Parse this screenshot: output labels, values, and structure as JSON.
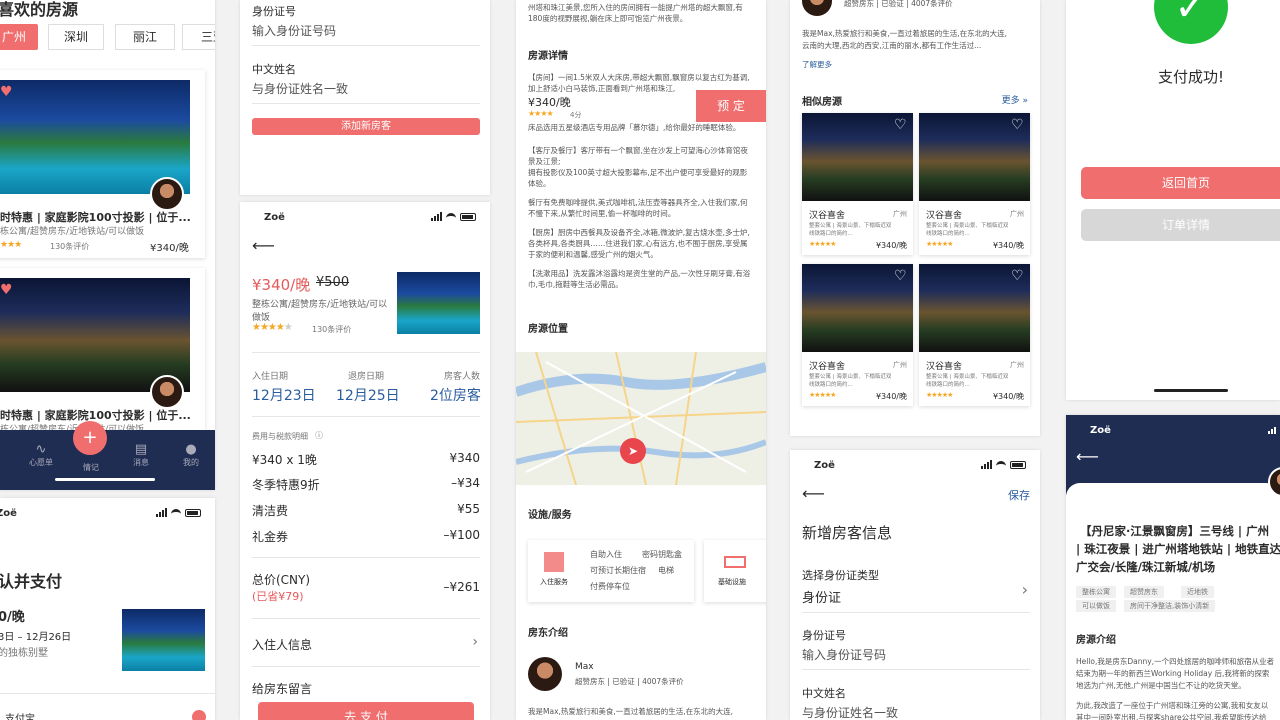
{
  "s1": {
    "title": "喜欢的房源",
    "cities": [
      "广州",
      "深圳",
      "丽江",
      "三亚"
    ],
    "card1_title": "时特惠 | 家庭影院100寸投影 | 位于...",
    "card1_sub": "栋公寓/超赞房东/近地铁站/可以做饭",
    "card1_reviews": "130条评价",
    "card1_price": "¥340/晚",
    "card2_title": "时特惠 | 家庭影院100寸投影 | 位于...",
    "card2_sub": "栋公寓/超赞房东/近地铁站/可以做饭",
    "nav": [
      "心愿单",
      "情记",
      "消息",
      "我的"
    ],
    "fab": "+"
  },
  "s2": {
    "name": "Zoë",
    "title": "认并支付",
    "price": "0/晚",
    "dates": "3日 – 12月26日",
    "desc": "的独栋别墅",
    "bottom": "支付宝"
  },
  "s3": {
    "id_label": "身份证号",
    "id_placeholder": "输入身份证号码",
    "name_label": "中文姓名",
    "name_placeholder": "与身份证姓名一致",
    "add_btn": "添加新房客"
  },
  "s4": {
    "name": "Zoë",
    "price": "¥340/晚",
    "orig": "¥500",
    "sub1": "整栋公寓/超赞房东/近地铁站/可以",
    "sub2": "做饭",
    "reviews": "130条评价",
    "checkin_label": "入住日期",
    "checkout_label": "退房日期",
    "guests_label": "房客人数",
    "checkin": "12月23日",
    "checkout": "12月25日",
    "guests": "2位房客",
    "fee_title": "费用与税款明细",
    "fees": [
      {
        "k": "¥340 x 1晚",
        "v": "¥340"
      },
      {
        "k": "冬季特惠9折",
        "v": "–¥34"
      },
      {
        "k": "清洁费",
        "v": "¥55"
      },
      {
        "k": "礼金券",
        "v": "–¥100"
      }
    ],
    "total_label": "总价(CNY)",
    "saved": "(已省¥79)",
    "total": "–¥261",
    "guest_info": "入住人信息",
    "msg": "给房东留言",
    "pay": "去 支 付"
  },
  "s5": {
    "intro_top": "州塔和珠江美景,您所入住的房间拥有一能提广州塔的超大飘窗,有180度的视野展视,躺在床上即可饱览广州夜景。",
    "detail_title": "房源详情",
    "detail": [
      "【房间】一间1.5米双人大床房,带超大飘窗,飘窗房以复古红为基调,加上舒适小白马装饰,正面看到广州塔和珠江,",
      "床品选用五星级酒店专用品牌「慕尔德」,给你最好的睡眠体验。",
      "【客厅及餐厅】客厅带有一个飘窗,坐在沙发上可望海心沙体育馆夜景及江景;",
      "拥有投影仪及100英寸超大投影幕布,足不出户便可享受最好的观影体验。",
      "餐厅有免费咖啡提供,美式咖啡机,法压壶等器具齐全,入住我们家,何不慢下来,从繁忙时间里,偷一杯咖啡的时间。",
      "【厨房】厨房中西餐具及设备齐全,冰箱,微波炉,复古烧水壶,多士炉,各类杯具,各类厨具……住进我们家,心有远方,也不囿于厨房,享受属于家的便利和温馨,感受广州的烟火气。",
      "【洗漱用品】洗发露沐浴露均是资生堂的产品,一次性牙刷牙膏,有浴巾,毛巾,拖鞋等生活必需品。"
    ],
    "float_price": "¥340/晚",
    "float_rating": "4分",
    "book": "预 定",
    "loc_title": "房源位置",
    "fac_title": "设施/服务",
    "fac1_label": "入住服务",
    "fac1_items": [
      "自助入住",
      "密码钥匙盒",
      "可预订长期住宿",
      "电梯",
      "付费停车位"
    ],
    "fac2_label": "基础设施",
    "host_title": "房东介绍",
    "host_name": "Max",
    "host_info": "超赞房东 | 已验证 | 4007条评价",
    "host_text": "我是Max,热爱旅行和美食,一直过着旅居的生活,在东北的大连,"
  },
  "s6": {
    "host_info": "超赞房东 | 已验证 | 4007条评价",
    "host_text1": "我是Max,热爱旅行和美食,一直过着旅居的生活,在东北的大连,",
    "host_text2": "云南的大理,西北的西安,江南的丽水,都有工作生活过...",
    "more": "了解更多",
    "similar": "相似房源",
    "more2": "更多 »",
    "listings": [
      {
        "name": "汉谷喜舍",
        "city": "广州",
        "desc1": "整套公寓 | 海景山景、下榻临近双",
        "desc2": "线铁路口的简约...",
        "price": "¥340/晚"
      },
      {
        "name": "汉谷喜舍",
        "city": "广州",
        "desc1": "整套公寓 | 海景山景、下榻临近双",
        "desc2": "线铁路口的简约...",
        "price": "¥340/晚"
      },
      {
        "name": "汉谷喜舍",
        "city": "广州",
        "desc1": "整套公寓 | 海景山景、下榻临近双",
        "desc2": "线铁路口的简约...",
        "price": "¥340/晚"
      },
      {
        "name": "汉谷喜舍",
        "city": "广州",
        "desc1": "整套公寓 | 海景山景、下榻临近双",
        "desc2": "线铁路口的简约...",
        "price": "¥340/晚"
      }
    ]
  },
  "s7": {
    "name": "Zoë",
    "save": "保存",
    "title": "新增房客信息",
    "type_label": "选择身份证类型",
    "type_value": "身份证",
    "id_label": "身份证号",
    "id_placeholder": "输入身份证号码",
    "name_label": "中文姓名",
    "name_placeholder": "与身份证姓名一致"
  },
  "s8": {
    "success": "支付成功!",
    "home": "返回首页",
    "order": "订单详情"
  },
  "s9": {
    "name": "Zoë",
    "title1": "【丹尼家·江景飘窗房】三号线 | 广州",
    "title2": "| 珠江夜景 | 进广州塔地铁站 | 地铁直达",
    "title3": "广交会/长隆/珠江新城/机场",
    "tags1": [
      "整栋公寓",
      "超赞房东",
      "近地铁"
    ],
    "tags2": [
      "可以做饭",
      "房间干净整洁,装饰小清新"
    ],
    "intro": "房源介绍",
    "text": [
      "Hello,我是房东Danny,一个四处旅居的咖啡师和旅宿从业者",
      "结束为期一年的新西兰Working Holiday 后,我将新的探索",
      "地选为广州,无他,广州是中国当仁不让的吃货天堂。",
      "为此,我改造了一座位于广州塔和珠江旁的公寓,我和女友以",
      "其中一间卧室出租,与探客share公共空间,我希望能传达给"
    ]
  },
  "colors": {
    "accent": "#f06e6e",
    "navy": "#1f2d52",
    "blue": "#2a5d9f",
    "green": "#1fbd3a"
  }
}
